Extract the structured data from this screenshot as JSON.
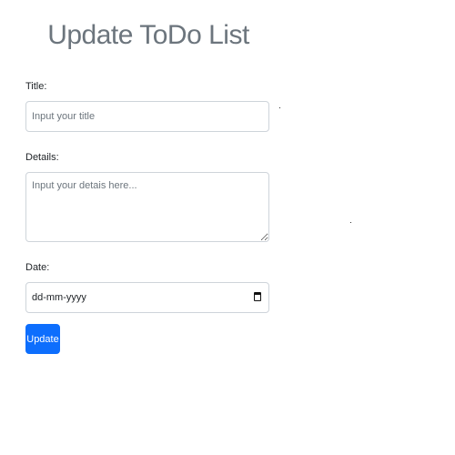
{
  "header": {
    "title": "Update ToDo List"
  },
  "form": {
    "title_label": "Title:",
    "title_placeholder": "Input your title",
    "details_label": "Details:",
    "details_placeholder": "Input your detais here...",
    "date_label": "Date:",
    "date_value": "dd-mm-yyyy",
    "date_icon": "calendar-icon",
    "submit_label": "Update"
  },
  "colors": {
    "title": "#6c757d",
    "primary_button": "#0d6efd",
    "input_border": "#ced4da"
  }
}
